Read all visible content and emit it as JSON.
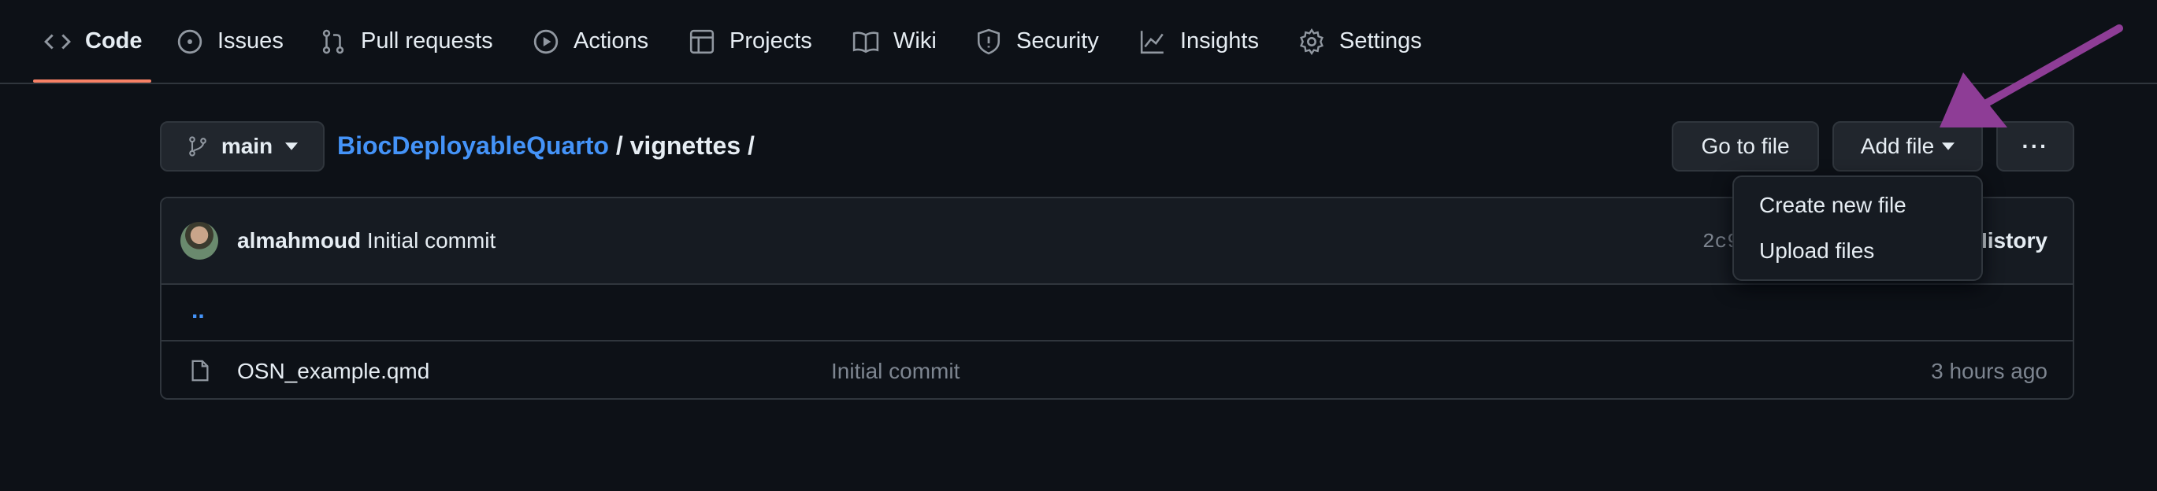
{
  "tabs": [
    {
      "label": "Code",
      "icon": "code-icon"
    },
    {
      "label": "Issues",
      "icon": "issue-opened-icon"
    },
    {
      "label": "Pull requests",
      "icon": "git-pull-request-icon"
    },
    {
      "label": "Actions",
      "icon": "play-icon"
    },
    {
      "label": "Projects",
      "icon": "table-icon"
    },
    {
      "label": "Wiki",
      "icon": "book-icon"
    },
    {
      "label": "Security",
      "icon": "shield-icon"
    },
    {
      "label": "Insights",
      "icon": "graph-icon"
    },
    {
      "label": "Settings",
      "icon": "gear-icon"
    }
  ],
  "branch": {
    "name": "main"
  },
  "breadcrumb": {
    "repo": "BiocDeployableQuarto",
    "sep1": " / ",
    "folder": "vignettes",
    "sep2": " /"
  },
  "toolbar": {
    "go_to_file": "Go to file",
    "add_file": "Add file",
    "more": "···"
  },
  "add_file_menu": {
    "items": [
      "Create new file",
      "Upload files"
    ]
  },
  "commit": {
    "author": "almahmoud",
    "message": "Initial commit",
    "sha_partial": "2c9",
    "history_partial": "History"
  },
  "parent_dir": {
    "label": ".."
  },
  "files": [
    {
      "name": "OSN_example.qmd",
      "commit_message": "Initial commit",
      "age": "3 hours ago"
    }
  ],
  "colors": {
    "accent_underline": "#f78166",
    "link": "#4493f8",
    "annotation_arrow": "#8e3d96"
  }
}
